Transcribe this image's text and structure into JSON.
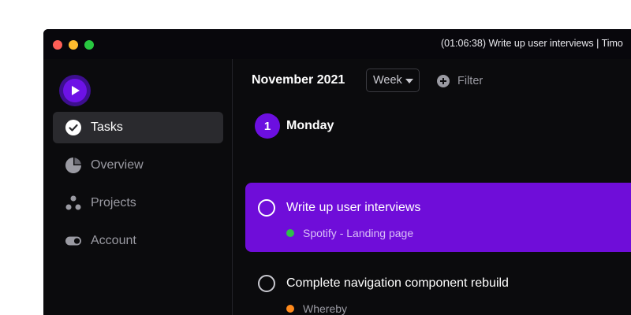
{
  "window": {
    "title": "(01:06:38) Write up user interviews | Timo"
  },
  "sidebar": {
    "logo_icon": "play-icon",
    "items": [
      {
        "label": "Tasks",
        "icon": "check-circle-icon",
        "active": true
      },
      {
        "label": "Overview",
        "icon": "pie-chart-icon",
        "active": false
      },
      {
        "label": "Projects",
        "icon": "projects-dots-icon",
        "active": false
      },
      {
        "label": "Account",
        "icon": "toggle-icon",
        "active": false
      }
    ]
  },
  "header": {
    "month": "November 2021",
    "view_select": "Week",
    "filter_label": "Filter"
  },
  "day": {
    "number": "1",
    "name": "Monday"
  },
  "tasks": [
    {
      "title": "Write up user interviews",
      "project": "Spotify - Landing page",
      "project_color": "#2fbf4a",
      "highlighted": true
    },
    {
      "title": "Complete navigation component rebuild",
      "project": "Whereby",
      "project_color": "#ff8a1c",
      "highlighted": false
    }
  ],
  "colors": {
    "accent": "#6f0dd9",
    "background": "#0b0b0d",
    "active_nav": "#2a2a2e"
  }
}
